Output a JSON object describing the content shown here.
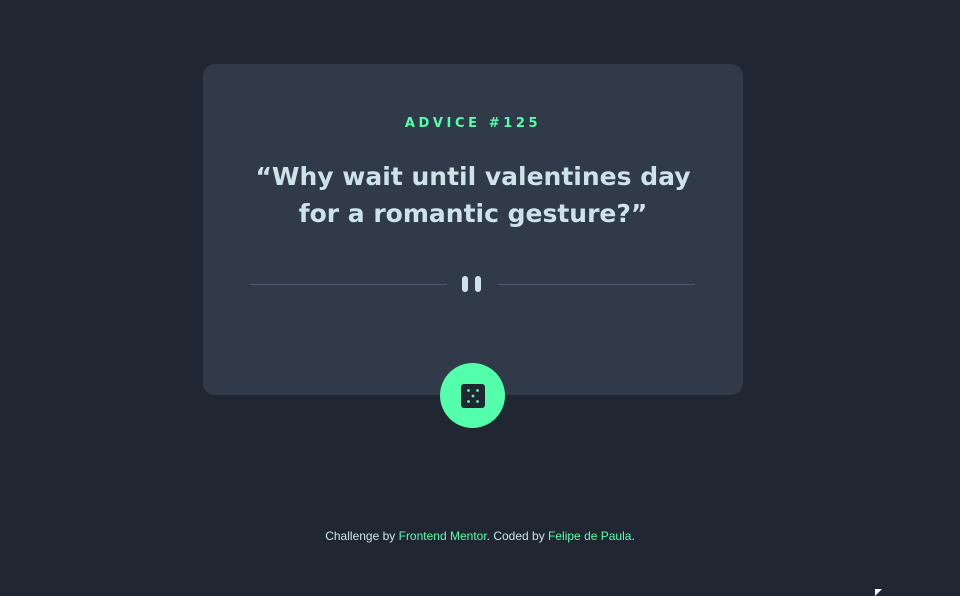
{
  "advice": {
    "id_label": "ADVICE #125",
    "quote": "“Why wait until valentines day for a romantic gesture?”"
  },
  "divider": {
    "icon": "pause-icon"
  },
  "dice_button": {
    "icon": "dice-icon"
  },
  "footer": {
    "prefix": "Challenge by ",
    "challenge_link": "Frontend Mentor",
    "middle": ". Coded by ",
    "author_link": "Felipe de Paula",
    "suffix": "."
  },
  "colors": {
    "background": "#202733",
    "card": "#313a48",
    "accent": "#53ffaa",
    "text": "#cee3e9",
    "divider_line": "#4f5d74"
  }
}
